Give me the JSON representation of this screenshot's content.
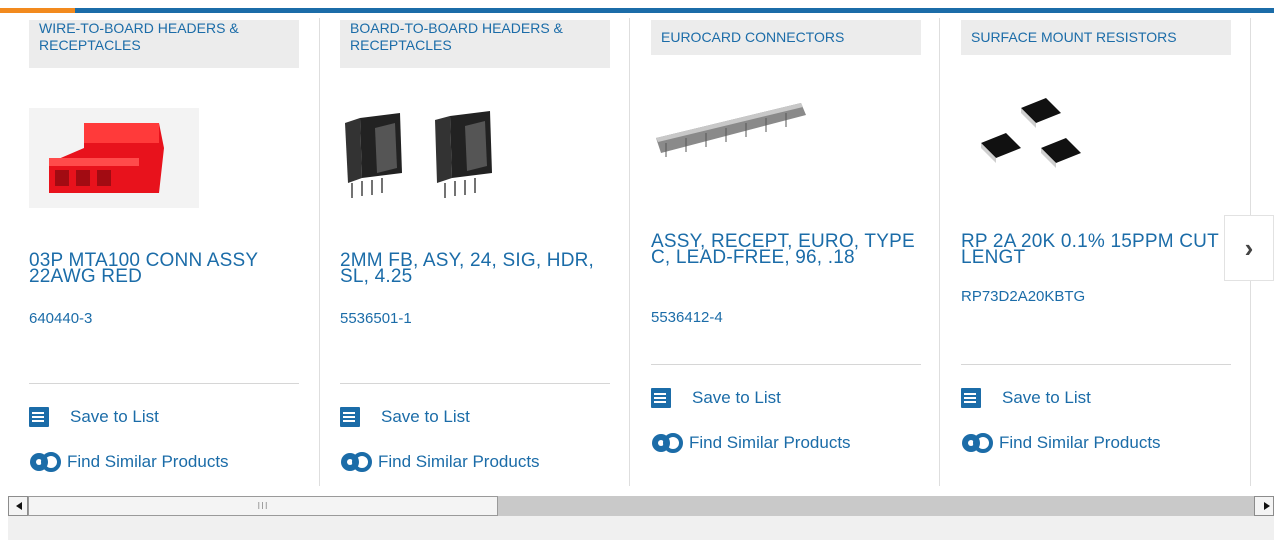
{
  "accent_colors": {
    "brand_blue": "#1b6ca8",
    "orange": "#f28a1e"
  },
  "actions": {
    "save_label": "Save to List",
    "similar_label": "Find Similar Products"
  },
  "cards": [
    {
      "category": "WIRE-TO-BOARD HEADERS & RECEPTACLES",
      "title": "03P MTA100 CONN ASSY 22AWG RED",
      "part_number": "640440-3",
      "image": "red-connector-image"
    },
    {
      "category": "BOARD-TO-BOARD HEADERS & RECEPTACLES",
      "title": "2MM FB, ASY, 24, SIG, HDR, SL, 4.25",
      "part_number": "5536501-1",
      "image": "black-headers-image"
    },
    {
      "category": "EUROCARD CONNECTORS",
      "title": "ASSY, RECEPT, EURO, TYPE C, LEAD-FREE, 96, .18",
      "part_number": "5536412-4",
      "image": "eurocard-connector-image"
    },
    {
      "category": "SURFACE MOUNT RESISTORS",
      "title": "RP 2A 20K 0.1% 15PPM CUT LENGT",
      "part_number": "RP73D2A20KBTG",
      "image": "smd-resistors-image"
    }
  ],
  "carousel": {
    "next_icon": "chevron-right-icon",
    "next_glyph": "›"
  },
  "scrollbar": {
    "grip": "III"
  }
}
